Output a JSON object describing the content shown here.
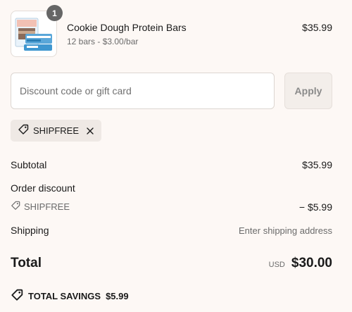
{
  "cart_item": {
    "quantity": "1",
    "name": "Cookie Dough Protein Bars",
    "variant": "12 bars - $3.00/bar",
    "price": "$35.99",
    "image_icon": "product-package-image"
  },
  "discount": {
    "placeholder": "Discount code or gift card",
    "value": "",
    "apply_label": "Apply",
    "applied_code": "SHIPFREE"
  },
  "summary": {
    "subtotal_label": "Subtotal",
    "subtotal_value": "$35.99",
    "order_discount_label": "Order discount",
    "order_discount_code": "SHIPFREE",
    "order_discount_value": "− $5.99",
    "shipping_label": "Shipping",
    "shipping_value": "Enter shipping address",
    "total_label": "Total",
    "currency": "USD",
    "total_value": "$30.00",
    "savings_label": "TOTAL SAVINGS",
    "savings_value": "$5.99"
  },
  "colors": {
    "background": "#fdf8f5",
    "badge": "#666666",
    "chip": "#efe9e5",
    "muted_text": "#6b6b6b"
  }
}
